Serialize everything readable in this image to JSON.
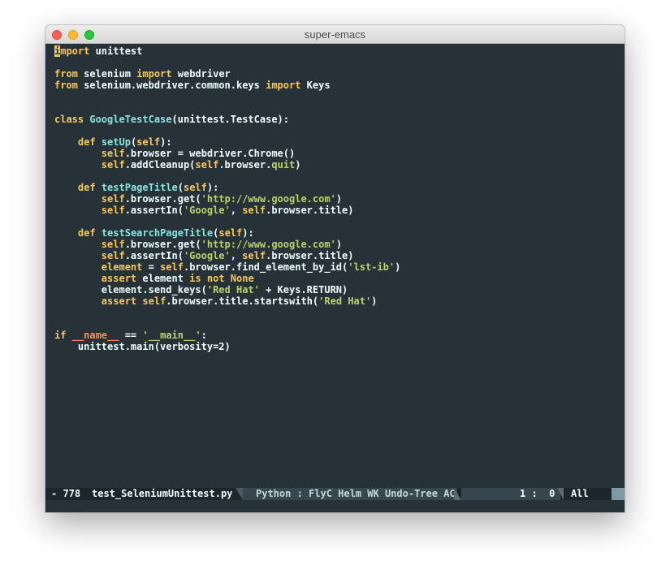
{
  "window": {
    "title": "super-emacs"
  },
  "code": [
    [
      {
        "t": "import",
        "c": "kw",
        "cursor": true
      },
      {
        "t": " unittest",
        "c": "pl"
      }
    ],
    [],
    [
      {
        "t": "from",
        "c": "kw"
      },
      {
        "t": " selenium ",
        "c": "pl"
      },
      {
        "t": "import",
        "c": "kw"
      },
      {
        "t": " webdriver",
        "c": "pl"
      }
    ],
    [
      {
        "t": "from",
        "c": "kw"
      },
      {
        "t": " selenium.webdriver.common.keys ",
        "c": "pl"
      },
      {
        "t": "import",
        "c": "kw"
      },
      {
        "t": " Keys",
        "c": "pl"
      }
    ],
    [],
    [],
    [
      {
        "t": "class",
        "c": "kw"
      },
      {
        "t": " ",
        "c": "pl"
      },
      {
        "t": "GoogleTestCase",
        "c": "cls"
      },
      {
        "t": "(unittest.TestCase):",
        "c": "pl"
      }
    ],
    [],
    [
      {
        "t": "    ",
        "c": "pl"
      },
      {
        "t": "def",
        "c": "kw"
      },
      {
        "t": " ",
        "c": "pl"
      },
      {
        "t": "setUp",
        "c": "fn"
      },
      {
        "t": "(",
        "c": "pl"
      },
      {
        "t": "self",
        "c": "self"
      },
      {
        "t": "):",
        "c": "pl"
      }
    ],
    [
      {
        "t": "        ",
        "c": "pl"
      },
      {
        "t": "self",
        "c": "self"
      },
      {
        "t": ".browser = webdriver.Chrome()",
        "c": "pl"
      }
    ],
    [
      {
        "t": "        ",
        "c": "pl"
      },
      {
        "t": "self",
        "c": "self"
      },
      {
        "t": ".addCleanup(",
        "c": "pl"
      },
      {
        "t": "self",
        "c": "self"
      },
      {
        "t": ".browser.",
        "c": "pl"
      },
      {
        "t": "quit",
        "c": "str"
      },
      {
        "t": ")",
        "c": "pl"
      }
    ],
    [],
    [
      {
        "t": "    ",
        "c": "pl"
      },
      {
        "t": "def",
        "c": "kw"
      },
      {
        "t": " ",
        "c": "pl"
      },
      {
        "t": "testPageTitle",
        "c": "fn"
      },
      {
        "t": "(",
        "c": "pl"
      },
      {
        "t": "self",
        "c": "self"
      },
      {
        "t": "):",
        "c": "pl"
      }
    ],
    [
      {
        "t": "        ",
        "c": "pl"
      },
      {
        "t": "self",
        "c": "self"
      },
      {
        "t": ".browser.get(",
        "c": "pl"
      },
      {
        "t": "'http://www.google.com'",
        "c": "str"
      },
      {
        "t": ")",
        "c": "pl"
      }
    ],
    [
      {
        "t": "        ",
        "c": "pl"
      },
      {
        "t": "self",
        "c": "self"
      },
      {
        "t": ".assertIn(",
        "c": "pl"
      },
      {
        "t": "'Google'",
        "c": "str"
      },
      {
        "t": ", ",
        "c": "pl"
      },
      {
        "t": "self",
        "c": "self"
      },
      {
        "t": ".browser.title)",
        "c": "pl"
      }
    ],
    [],
    [
      {
        "t": "    ",
        "c": "pl"
      },
      {
        "t": "def",
        "c": "kw"
      },
      {
        "t": " ",
        "c": "pl"
      },
      {
        "t": "testSearchPageTitle",
        "c": "fn"
      },
      {
        "t": "(",
        "c": "pl"
      },
      {
        "t": "self",
        "c": "self"
      },
      {
        "t": "):",
        "c": "pl"
      }
    ],
    [
      {
        "t": "        ",
        "c": "pl"
      },
      {
        "t": "self",
        "c": "self"
      },
      {
        "t": ".browser.get(",
        "c": "pl"
      },
      {
        "t": "'http://www.google.com'",
        "c": "str"
      },
      {
        "t": ")",
        "c": "pl"
      }
    ],
    [
      {
        "t": "        ",
        "c": "pl"
      },
      {
        "t": "self",
        "c": "self"
      },
      {
        "t": ".assertIn(",
        "c": "pl"
      },
      {
        "t": "'Google'",
        "c": "str"
      },
      {
        "t": ", ",
        "c": "pl"
      },
      {
        "t": "self",
        "c": "self"
      },
      {
        "t": ".browser.title)",
        "c": "pl"
      }
    ],
    [
      {
        "t": "        ",
        "c": "pl"
      },
      {
        "t": "element",
        "c": "var"
      },
      {
        "t": " = ",
        "c": "pl"
      },
      {
        "t": "self",
        "c": "self"
      },
      {
        "t": ".browser.find_element_by_id(",
        "c": "pl"
      },
      {
        "t": "'lst-ib'",
        "c": "str"
      },
      {
        "t": ")",
        "c": "pl"
      }
    ],
    [
      {
        "t": "        ",
        "c": "pl"
      },
      {
        "t": "assert",
        "c": "kw"
      },
      {
        "t": " element ",
        "c": "pl"
      },
      {
        "t": "is",
        "c": "kw"
      },
      {
        "t": " ",
        "c": "pl"
      },
      {
        "t": "not",
        "c": "kw"
      },
      {
        "t": " ",
        "c": "pl"
      },
      {
        "t": "None",
        "c": "const"
      }
    ],
    [
      {
        "t": "        element.send_keys(",
        "c": "pl"
      },
      {
        "t": "'Red Hat'",
        "c": "str"
      },
      {
        "t": " + Keys.RETURN)",
        "c": "pl"
      }
    ],
    [
      {
        "t": "        ",
        "c": "pl"
      },
      {
        "t": "assert",
        "c": "kw"
      },
      {
        "t": " ",
        "c": "pl"
      },
      {
        "t": "self",
        "c": "self"
      },
      {
        "t": ".browser.title.startswith(",
        "c": "pl"
      },
      {
        "t": "'Red Hat'",
        "c": "str"
      },
      {
        "t": ")",
        "c": "pl"
      }
    ],
    [],
    [],
    [
      {
        "t": "if",
        "c": "kw"
      },
      {
        "t": " ",
        "c": "pl"
      },
      {
        "t": "__name__",
        "c": "dunder"
      },
      {
        "t": " == ",
        "c": "pl"
      },
      {
        "t": "'__main__'",
        "c": "str"
      },
      {
        "t": ":",
        "c": "pl"
      }
    ],
    [
      {
        "t": "    unittest.main(verbosity=2)",
        "c": "pl"
      }
    ]
  ],
  "modeline": {
    "state": "- 778",
    "filename": "test_SeleniumUnittest.py",
    "modes": "Python : FlyC Helm WK Undo-Tree AC",
    "position": "1 :  0",
    "scroll": "All"
  }
}
